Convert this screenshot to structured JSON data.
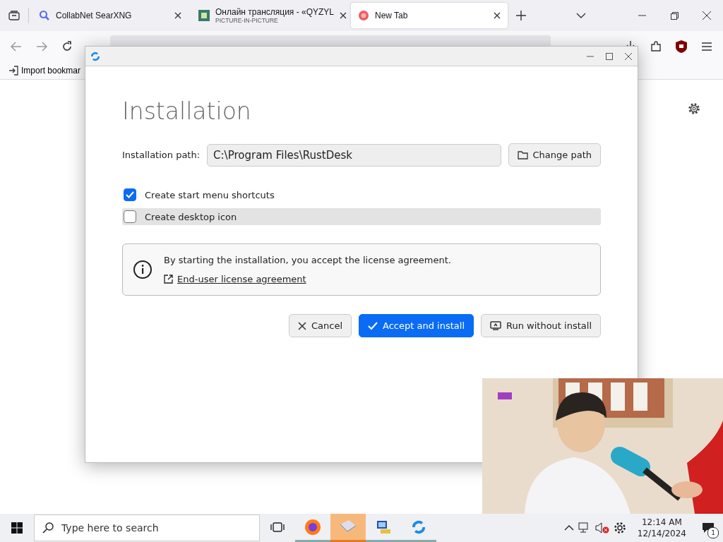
{
  "browser": {
    "tabs": [
      {
        "kind": "search",
        "title": "CollabNet SearXNG",
        "selected": false
      },
      {
        "kind": "video",
        "title": "Онлайн трансляция - «QYZYL",
        "subtitle": "PICTURE-IN-PICTURE",
        "selected": false
      },
      {
        "kind": "newtab",
        "title": "New Tab",
        "selected": true
      }
    ],
    "bookmarks": [
      "Import bookmar"
    ]
  },
  "dialog": {
    "title": "Installation",
    "path_label": "Installation path:",
    "path_value": "C:\\Program Files\\RustDesk",
    "change_path": "Change path",
    "options": [
      {
        "label": "Create start menu shortcuts",
        "checked": true,
        "hovered": false
      },
      {
        "label": "Create desktop icon",
        "checked": false,
        "hovered": true
      }
    ],
    "notice": "By starting the installation, you accept the license agreement.",
    "license_link": "End-user license agreement",
    "buttons": [
      {
        "kind": "cancel",
        "label": "Cancel"
      },
      {
        "kind": "primary",
        "label": "Accept and install"
      },
      {
        "kind": "run",
        "label": "Run without install"
      }
    ]
  },
  "taskbar": {
    "search_placeholder": "Type here to search",
    "apps": [
      {
        "kind": "firefox",
        "selected": false
      },
      {
        "kind": "mail",
        "selected": true
      },
      {
        "kind": "network",
        "selected": false
      },
      {
        "kind": "rustdesk",
        "selected": false
      }
    ],
    "time": "12:14 AM",
    "date": "12/14/2024",
    "notifications": "1"
  }
}
